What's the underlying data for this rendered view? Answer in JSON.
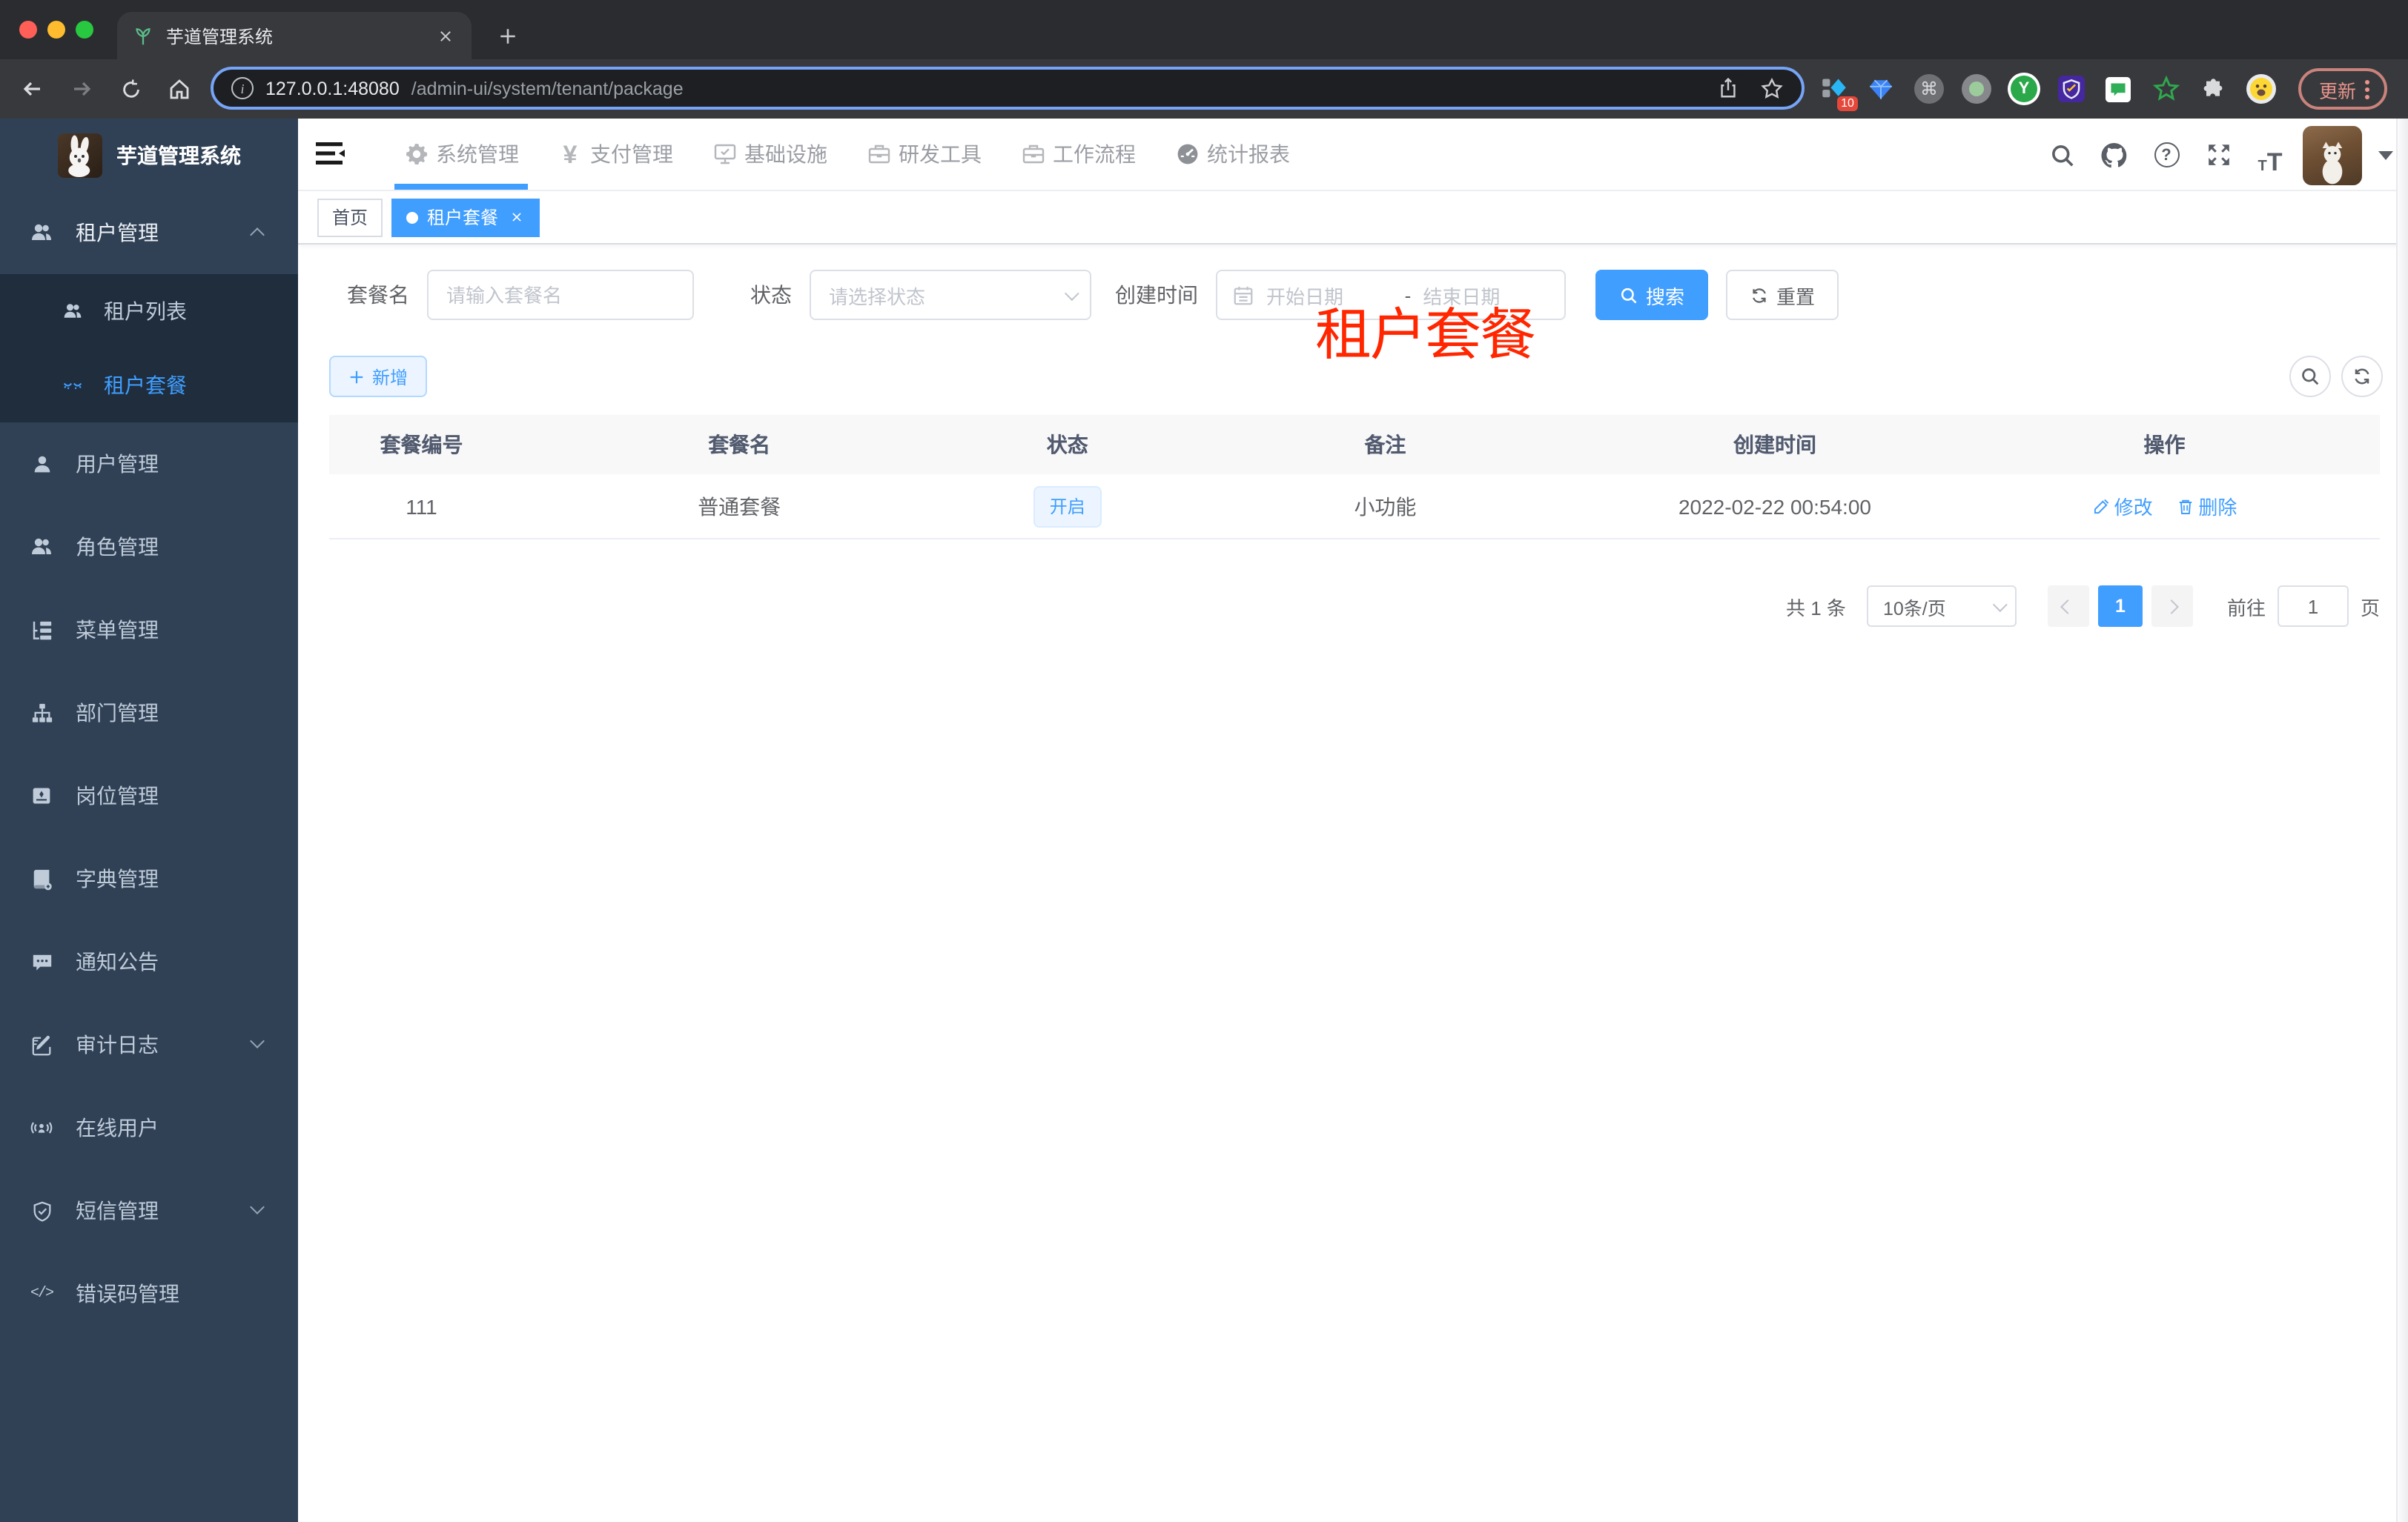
{
  "colors": {
    "accent": "#409eff",
    "sidebar_bg": "#304156",
    "submenu_bg": "#1f2d3d",
    "annotation_red": "#ff2600",
    "tag_active": "#409eff"
  },
  "browser": {
    "tab_title": "芋道管理系统",
    "address": {
      "host": "127.0.0.1:48080",
      "path": "/admin-ui/system/tenant/package"
    },
    "extensions": {
      "badge_count": "10",
      "cmd_glyph": "⌘",
      "y_glyph": "Y",
      "update_label": "更新"
    },
    "info_glyph": "i"
  },
  "sidebar": {
    "logo_title": "芋道管理系统",
    "items": [
      {
        "label": "租户管理"
      },
      {
        "label": "租户列表"
      },
      {
        "label": "租户套餐"
      },
      {
        "label": "用户管理"
      },
      {
        "label": "角色管理"
      },
      {
        "label": "菜单管理"
      },
      {
        "label": "部门管理"
      },
      {
        "label": "岗位管理"
      },
      {
        "label": "字典管理"
      },
      {
        "label": "通知公告"
      },
      {
        "label": "审计日志"
      },
      {
        "label": "在线用户"
      },
      {
        "label": "短信管理"
      },
      {
        "label": "错误码管理"
      }
    ],
    "code_icon_glyph": "</>"
  },
  "navbar": {
    "items": [
      {
        "label": "系统管理"
      },
      {
        "label": "支付管理"
      },
      {
        "label": "基础设施"
      },
      {
        "label": "研发工具"
      },
      {
        "label": "工作流程"
      },
      {
        "label": "统计报表"
      }
    ],
    "yen_glyph": "¥",
    "help_glyph": "?",
    "font_big": "T",
    "font_small": "T"
  },
  "tags": {
    "home": "首页",
    "active": "租户套餐"
  },
  "annotation": "租户套餐",
  "filters": {
    "name_label": "套餐名",
    "name_placeholder": "请输入套餐名",
    "status_label": "状态",
    "status_placeholder": "请选择状态",
    "time_label": "创建时间",
    "start_placeholder": "开始日期",
    "separator": "-",
    "end_placeholder": "结束日期",
    "search_label": "搜索",
    "reset_label": "重置"
  },
  "toolbar": {
    "add_label": "新增"
  },
  "table": {
    "headers": [
      "套餐编号",
      "套餐名",
      "状态",
      "备注",
      "创建时间",
      "操作"
    ],
    "rows": [
      {
        "id": "111",
        "name": "普通套餐",
        "status": "开启",
        "remark": "小功能",
        "created_at": "2022-02-22 00:54:00",
        "edit_label": "修改",
        "delete_label": "删除"
      }
    ]
  },
  "pagination": {
    "total": "共 1 条",
    "page_size": "10条/页",
    "current_page": "1",
    "goto_label": "前往",
    "goto_value": "1",
    "unit_label": "页"
  }
}
